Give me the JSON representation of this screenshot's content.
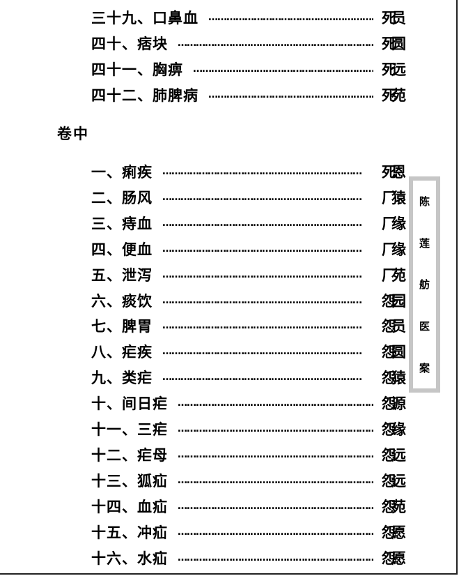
{
  "toc_top": [
    {
      "title": "三十九、口鼻血",
      "page_a": "死",
      "page_b": "员"
    },
    {
      "title": "四十、痞块",
      "page_a": "死",
      "page_b": "圆"
    },
    {
      "title": "四十一、胸痹",
      "page_a": "死",
      "page_b": "远"
    },
    {
      "title": "四十二、肺脾病",
      "page_a": "死",
      "page_b": "苑"
    }
  ],
  "section_title": "卷中",
  "toc_main": [
    {
      "title": "一、痢疾",
      "page_a": "死",
      "page_b": "恩"
    },
    {
      "title": "二、肠风",
      "page_a": "厂",
      "page_b": "猿"
    },
    {
      "title": "三、痔血",
      "page_a": "厂",
      "page_b": "缘"
    },
    {
      "title": "四、便血",
      "page_a": "厂",
      "page_b": "缘"
    },
    {
      "title": "五、泄泻",
      "page_a": "厂",
      "page_b": "苑"
    },
    {
      "title": "六、痰饮",
      "page_a": "怨",
      "page_b": "园"
    },
    {
      "title": "七、脾胃",
      "page_a": "怨",
      "page_b": "员"
    },
    {
      "title": "八、疟疾",
      "page_a": "怨",
      "page_b": "圆"
    },
    {
      "title": "九、类疟",
      "page_a": "怨",
      "page_b": "猿"
    },
    {
      "title": "十、间日疟",
      "page_a": "怨",
      "page_b": "源"
    },
    {
      "title": "十一、三疟",
      "page_a": "怨",
      "page_b": "缘"
    },
    {
      "title": "十二、疟母",
      "page_a": "怨",
      "page_b": "远"
    },
    {
      "title": "十三、狐疝",
      "page_a": "怨",
      "page_b": "远"
    },
    {
      "title": "十四、血疝",
      "page_a": "怨",
      "page_b": "苑"
    },
    {
      "title": "十五、冲疝",
      "page_a": "怨",
      "page_b": "愿"
    },
    {
      "title": "十六、水疝",
      "page_a": "怨",
      "page_b": "愿"
    }
  ],
  "leader_text": "…………………………………………………………",
  "side_tab": [
    "陈",
    "莲",
    "舫",
    "医",
    "案"
  ]
}
